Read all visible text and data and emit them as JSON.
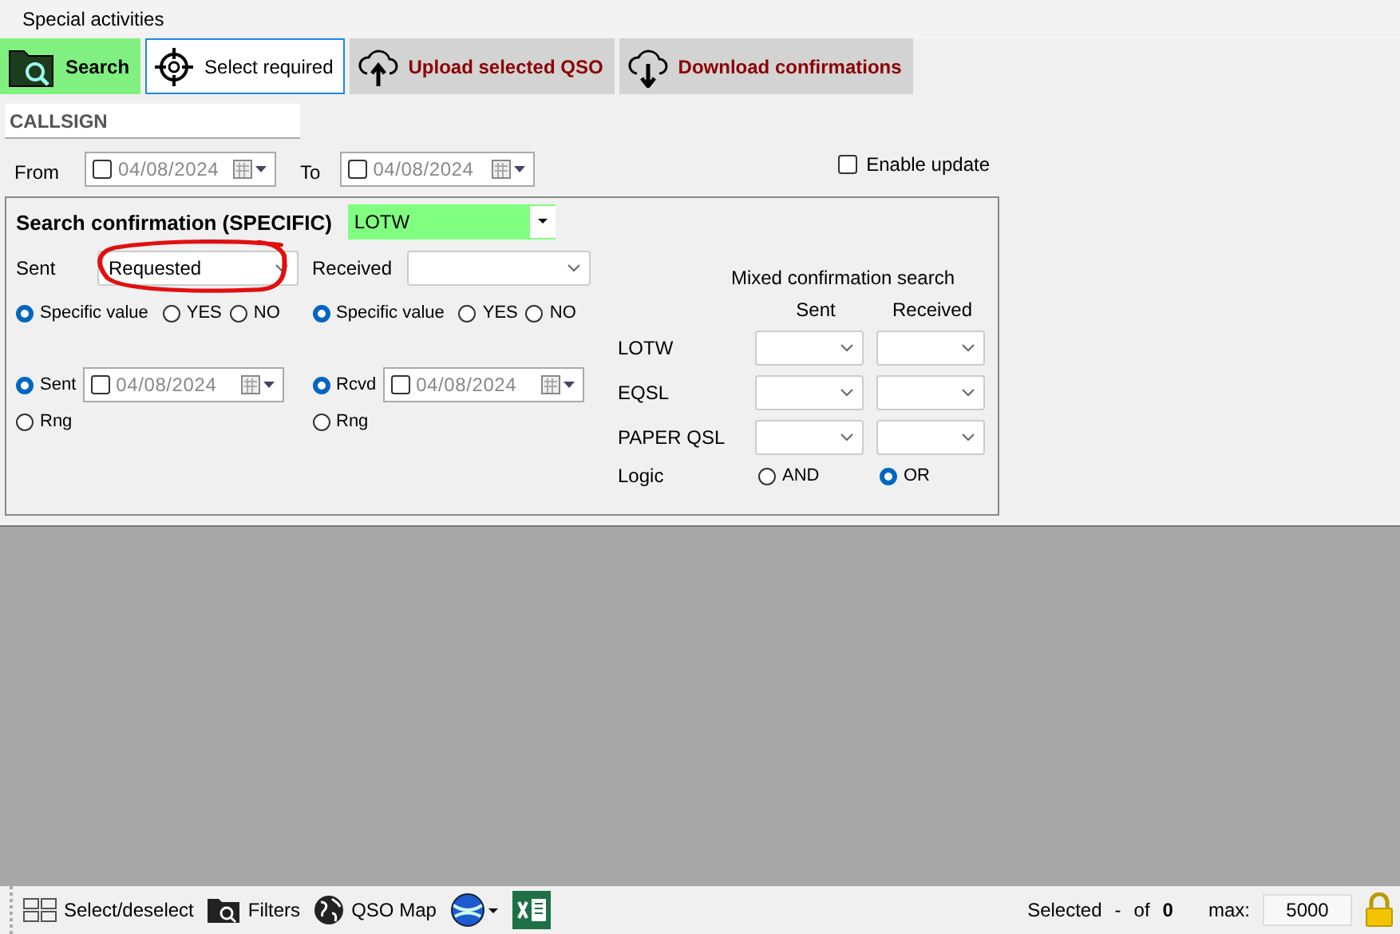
{
  "title": "Special activities",
  "toolbar": [
    {
      "label": "Search",
      "kind": "search"
    },
    {
      "label": "Select required",
      "kind": "target"
    },
    {
      "label": "Upload selected QSO",
      "kind": "upload"
    },
    {
      "label": "Download confirmations",
      "kind": "download"
    }
  ],
  "callsign": {
    "value": "CALLSIGN"
  },
  "from": {
    "label": "From",
    "checked": false,
    "value": "04/08/2024"
  },
  "to": {
    "label": "To",
    "checked": false,
    "value": "04/08/2024"
  },
  "enable_update": {
    "label": "Enable update",
    "checked": false
  },
  "specific": {
    "title": "Search confirmation (SPECIFIC)",
    "service": "LOTW",
    "sent": {
      "label": "Sent",
      "value": "Requested",
      "options": [
        {
          "label": "Specific value",
          "selected": true
        },
        {
          "label": "YES",
          "selected": false
        },
        {
          "label": "NO",
          "selected": false
        }
      ],
      "date_modes": [
        {
          "label": "Sent",
          "selected": true
        },
        {
          "label": "Rng",
          "selected": false
        }
      ],
      "date": {
        "checked": false,
        "value": "04/08/2024"
      }
    },
    "received": {
      "label": "Received",
      "options": [
        {
          "label": "Specific value",
          "selected": true
        },
        {
          "label": "YES",
          "selected": false
        },
        {
          "label": "NO",
          "selected": false
        }
      ],
      "date_modes": [
        {
          "label": "Rcvd",
          "selected": true
        },
        {
          "label": "Rng",
          "selected": false
        }
      ],
      "date": {
        "checked": false,
        "value": "04/08/2024"
      }
    }
  },
  "mixed": {
    "title": "Mixed confirmation search",
    "columns": [
      "Sent",
      "Received"
    ],
    "rows": [
      "LOTW",
      "EQSL",
      "PAPER QSL"
    ],
    "logic": {
      "label": "Logic",
      "options": [
        {
          "label": "AND",
          "selected": false
        },
        {
          "label": "OR",
          "selected": true
        }
      ]
    }
  },
  "status_bar": {
    "tools": [
      {
        "label": "Select/deselect",
        "kind": "grid"
      },
      {
        "label": "Filters",
        "kind": "folder"
      },
      {
        "label": "QSO Map",
        "kind": "globe"
      },
      {
        "kind": "earth"
      },
      {
        "kind": "sheet"
      }
    ],
    "selected_label": "Selected",
    "separator": "-",
    "of_label": "of",
    "count": "0",
    "max_label": "max:",
    "max": "5000",
    "locked": true
  }
}
